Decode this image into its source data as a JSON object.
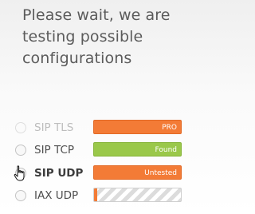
{
  "title": "Please wait, we are testing possible configurations",
  "colors": {
    "orange": "#f37b36",
    "green": "#9ac84a",
    "text": "#5b5b5b"
  },
  "options": [
    {
      "label": "SIP TLS",
      "status": "PRO",
      "bar_color": "orange",
      "faded": true
    },
    {
      "label": "SIP TCP",
      "status": "Found",
      "bar_color": "green",
      "faded": false
    },
    {
      "label": "SIP UDP",
      "status": "Untested",
      "bar_color": "orange",
      "bold": true
    },
    {
      "label": "IAX UDP",
      "status": "",
      "progress": 0.04
    }
  ],
  "cursor_icon": "hand-pointer-icon"
}
